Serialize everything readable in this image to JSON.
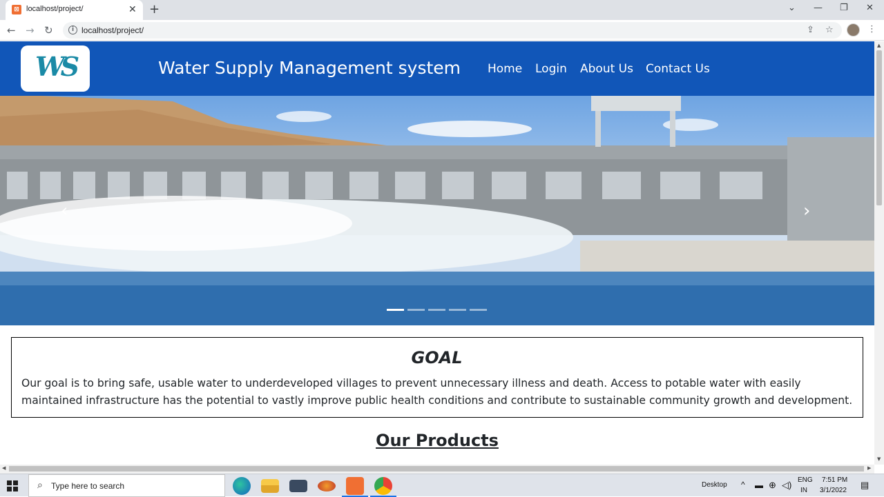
{
  "browser": {
    "tab_title": "localhost/project/",
    "tab_close": "✕",
    "new_tab": "+",
    "window_controls": [
      "⌄",
      "—",
      "❐",
      "✕"
    ],
    "url": "localhost/project/"
  },
  "site": {
    "logo_text": "WS",
    "title": "Water Supply Management system",
    "nav": [
      "Home",
      "Login",
      "About Us",
      "Contact Us"
    ]
  },
  "carousel": {
    "prev_glyph": "‹",
    "next_glyph": "›",
    "slide_count": 5,
    "active_slide": 1
  },
  "goal": {
    "heading": "GOAL",
    "text": "Our goal is to bring safe, usable water to underdeveloped villages to prevent unnecessary illness and death. Access to potable water with easily maintained infrastructure has the potential to vastly improve public health conditions and contribute to sustainable community growth and development."
  },
  "products": {
    "heading": "Our Products"
  },
  "taskbar": {
    "search_placeholder": "Type here to search",
    "desktop_label": "Desktop",
    "lang_top": "ENG",
    "lang_bottom": "IN",
    "time": "7:51 PM",
    "date": "3/1/2022"
  },
  "colors": {
    "header_bg": "#1156b8",
    "chrome_bg": "#dee1e6",
    "taskbar_bg": "#dfe3ea"
  }
}
